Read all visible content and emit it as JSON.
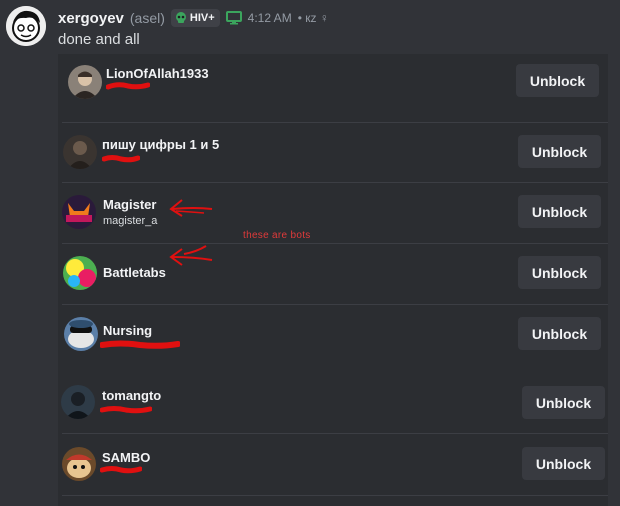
{
  "message": {
    "author": "xergoyev",
    "alias": "(asel)",
    "tag": "HIV+",
    "time": "4:12 AM",
    "extra": "• кz ♀",
    "text": "done and all"
  },
  "annotation": {
    "note": "these are bots",
    "color": "#e03a3a"
  },
  "blocked_users": [
    {
      "name": "LionOfAllah1933",
      "sub": "",
      "button": "Unblock",
      "avatar": "person-photo"
    },
    {
      "name": "пишу цифры 1 и 5",
      "sub": "",
      "button": "Unblock",
      "avatar": "dark-figure"
    },
    {
      "name": "Magister",
      "sub": "magister_a",
      "button": "Unblock",
      "avatar": "fox-logo"
    },
    {
      "name": "Battletabs",
      "sub": "",
      "button": "Unblock",
      "avatar": "colorful-logo"
    },
    {
      "name": "Nursing",
      "sub": "",
      "button": "Unblock",
      "avatar": "cartoon-blue"
    },
    {
      "name": "tomangto",
      "sub": "",
      "button": "Unblock",
      "avatar": "dark-figure"
    },
    {
      "name": "SAMBO",
      "sub": "",
      "button": "Unblock",
      "avatar": "cartoon-hat"
    }
  ],
  "colors": {
    "background": "#313338",
    "panel": "#2b2d31",
    "button": "#383a40",
    "scribble": "#e01010"
  }
}
